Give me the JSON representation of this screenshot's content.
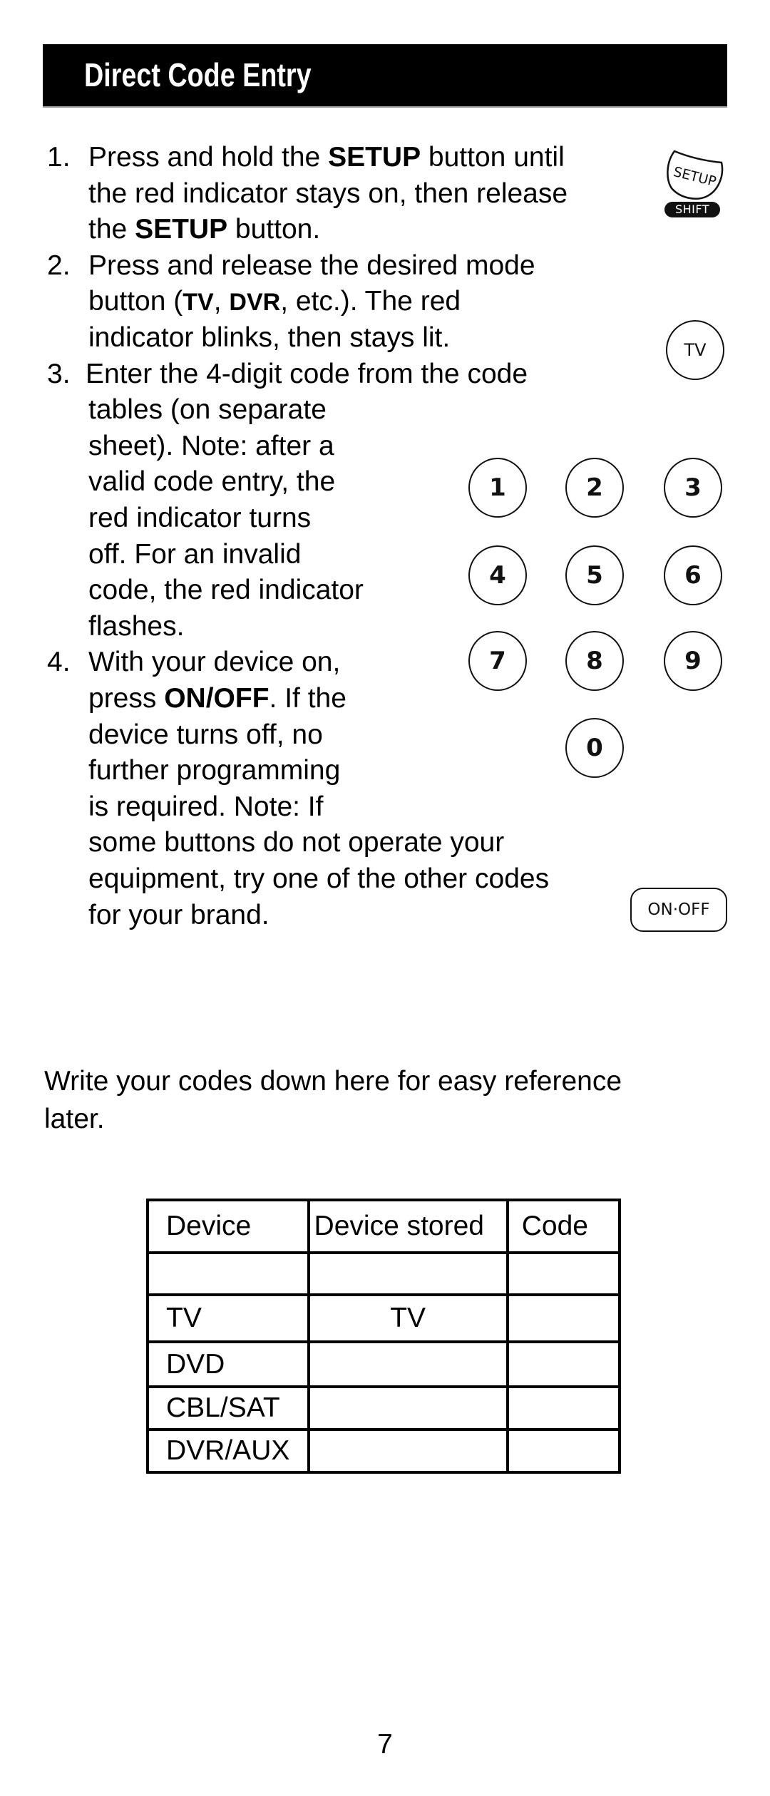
{
  "header": {
    "title": "Direct Code Entry"
  },
  "steps": [
    {
      "number": "1.",
      "lines": [
        [
          "Press and hold the ",
          {
            "b": "SETUP"
          },
          " button until"
        ],
        [
          "the red indicator stays on, then release"
        ],
        [
          "the ",
          {
            "b": "SETUP"
          },
          " button."
        ]
      ]
    },
    {
      "number": "2.",
      "lines": [
        [
          "Press and release the desired mode"
        ],
        [
          "button (",
          {
            "bs": "TV"
          },
          ", ",
          {
            "bs": "DVR"
          },
          ", etc.). The red"
        ],
        [
          "indicator blinks, then stays lit."
        ]
      ]
    },
    {
      "number": "3.",
      "lines": [
        [
          "Enter the 4-digit code from the code"
        ],
        [
          "tables (on separate"
        ],
        [
          "sheet). Note: after a"
        ],
        [
          "valid code entry, the"
        ],
        [
          "red indicator turns"
        ],
        [
          "off.  For an invalid"
        ],
        [
          "code, the red indicator"
        ],
        [
          "flashes."
        ]
      ]
    },
    {
      "number": "4.",
      "lines": [
        [
          "With your device on,"
        ],
        [
          "press ",
          {
            "b": "ON/OFF"
          },
          ". If the"
        ],
        [
          "device turns off, no"
        ],
        [
          "further programming"
        ],
        [
          "is required. Note: If"
        ],
        [
          "some buttons do not operate your"
        ],
        [
          "equipment, try one of the other codes"
        ],
        [
          "for your brand."
        ]
      ]
    }
  ],
  "remote_buttons": {
    "setup": {
      "label": "SETUP",
      "icon": "setup-button-icon"
    },
    "shift": {
      "label": "SHIFT",
      "icon": "shift-label-icon"
    },
    "tv": {
      "label": "TV",
      "icon": "tv-button-icon"
    },
    "digits": [
      "1",
      "2",
      "3",
      "4",
      "5",
      "6",
      "7",
      "8",
      "9",
      "0"
    ],
    "onoff": {
      "label": "ON·OFF",
      "icon": "on-off-button-icon"
    }
  },
  "note": {
    "line1": "Write your codes down here for easy reference",
    "line2": "later."
  },
  "code_table": {
    "headers": [
      "Device",
      "Device stored",
      "Code"
    ],
    "rows": [
      [
        "",
        "",
        ""
      ],
      [
        "TV",
        "TV",
        ""
      ],
      [
        "DVD",
        "",
        ""
      ],
      [
        "CBL/SAT",
        "",
        ""
      ],
      [
        "DVR/AUX",
        "",
        ""
      ]
    ]
  },
  "page_number": "7"
}
